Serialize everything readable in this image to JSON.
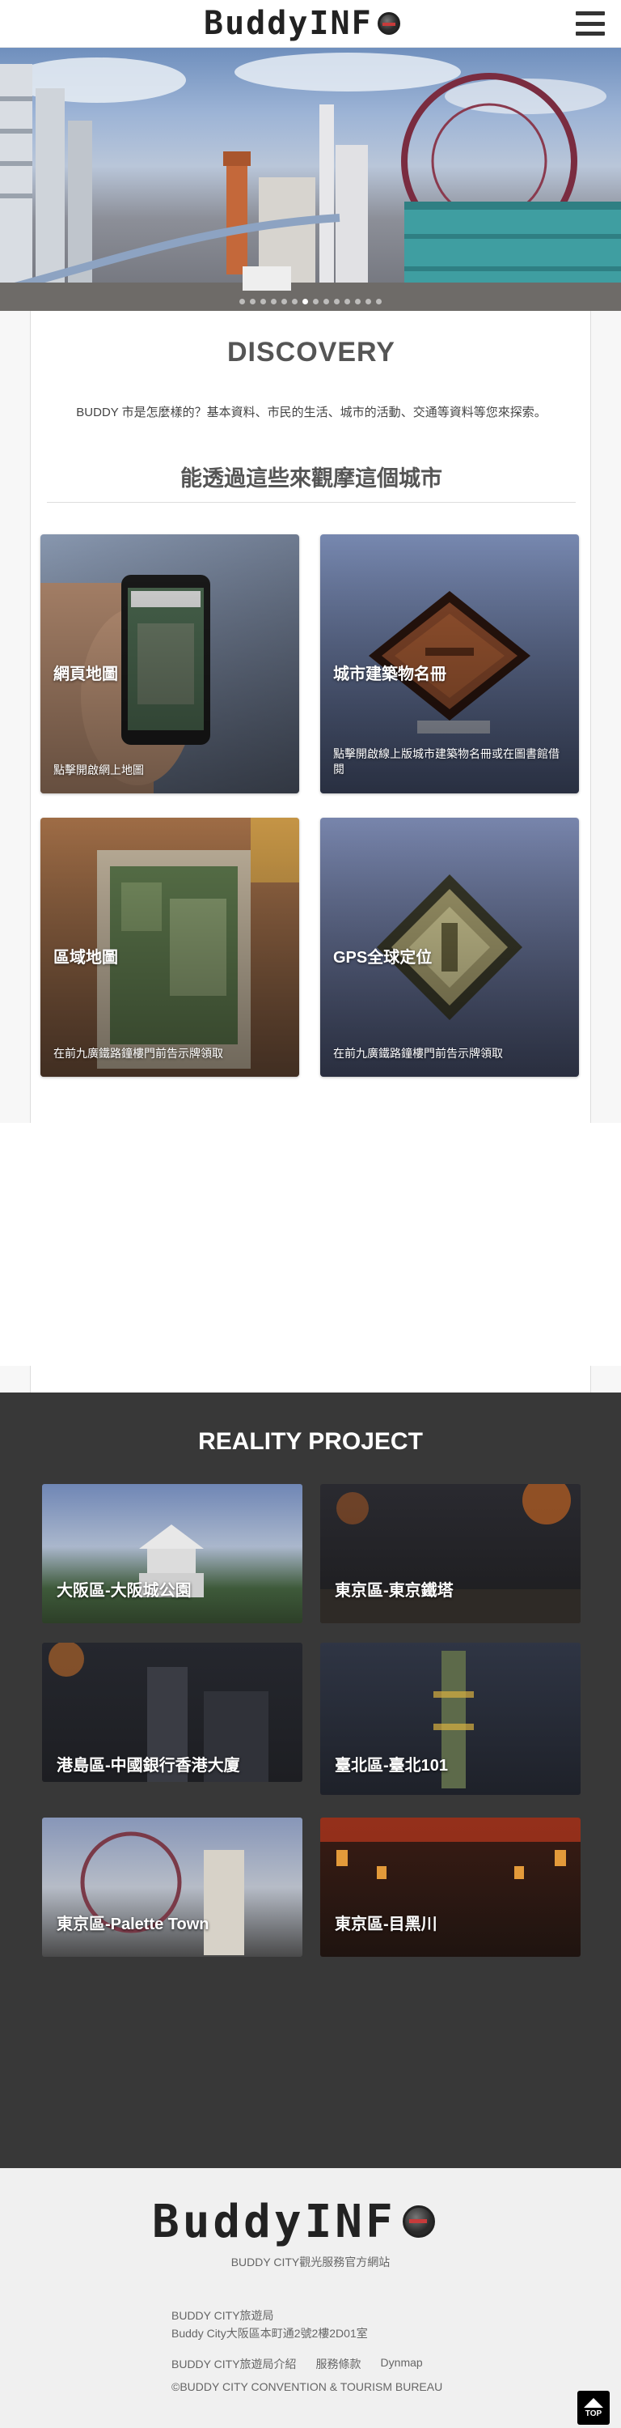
{
  "header": {
    "logo_text": "BuddyINF",
    "menu_icon": "hamburger-icon"
  },
  "hero": {
    "carousel_dot_count": 14,
    "active_dot": 6
  },
  "discovery": {
    "title": "DISCOVERY",
    "description": "BUDDY 市是怎麼樣的？基本資料、市民的生活、城市的活動、交通等資料等您來探索。",
    "subtitle": "能透過這些來觀摩這個城市",
    "cards": [
      {
        "title": "網頁地圖",
        "desc": "點擊開啟網上地圖"
      },
      {
        "title": "城市建築物名冊",
        "desc": "點擊開啟線上版城市建築物名冊或在圖書館借閱"
      },
      {
        "title": "區域地圖",
        "desc": "在前九廣鐵路鐘樓門前告示牌領取"
      },
      {
        "title": "GPS全球定位",
        "desc": "在前九廣鐵路鐘樓門前告示牌領取"
      }
    ]
  },
  "reality": {
    "title": "REALITY PROJECT",
    "cards": [
      {
        "label": "大阪區-大阪城公園"
      },
      {
        "label": "東京區-東京鐵塔"
      },
      {
        "label": "港島區-中國銀行香港大廈"
      },
      {
        "label": "臺北區-臺北101"
      },
      {
        "label": "東京區-Palette Town"
      },
      {
        "label": "東京區-目黑川"
      }
    ]
  },
  "footer": {
    "logo_text": "BuddyINF",
    "tagline": "BUDDY CITY觀光服務官方網站",
    "org": "BUDDY CITY旅遊局",
    "address": "Buddy City大阪區本町通2號2樓2D01室",
    "links": [
      "BUDDY CITY旅遊局介紹",
      "服務條款",
      "Dynmap"
    ],
    "copyright": "©BUDDY CITY CONVENTION & TOURISM BUREAU",
    "top_button": "TOP"
  }
}
